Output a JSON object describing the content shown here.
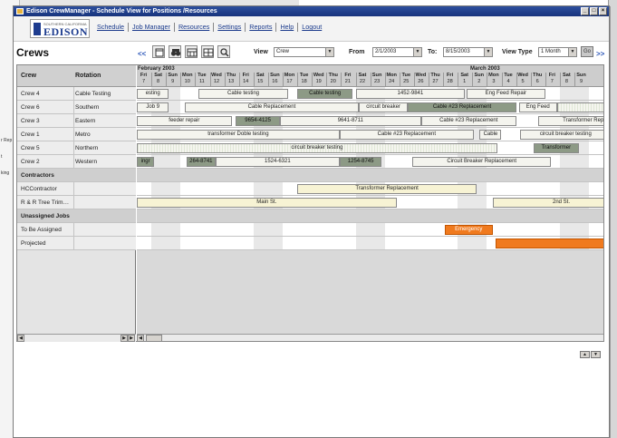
{
  "window": {
    "title": "Edison CrewManager - Schedule View for Positions /Resources"
  },
  "background_doc": {
    "snippets": [
      "r Rep",
      "t",
      "king"
    ]
  },
  "logo": {
    "small": "SOUTHERN CALIFORNIA",
    "big": "EDISON"
  },
  "nav": [
    "Schedule",
    "Job Manager",
    "Resources",
    "Settings",
    "Reports",
    "Help",
    "Logout"
  ],
  "toolbar": {
    "title": "Crews",
    "prev": "<<",
    "next": ">>",
    "view_label": "View",
    "view_value": "Crew",
    "from_label": "From",
    "from_value": "2/1/2003",
    "to_label": "To:",
    "to_value": "8/15/2003",
    "viewtype_label": "View Type",
    "viewtype_value": "1 Month",
    "go": "Go"
  },
  "grid": {
    "col_crew": "Crew",
    "col_rotation": "Rotation",
    "months": [
      "February 2003",
      "March 2003"
    ],
    "days": [
      {
        "d": "Fri",
        "n": "7"
      },
      {
        "d": "Sat",
        "n": "8"
      },
      {
        "d": "Sun",
        "n": "9"
      },
      {
        "d": "Mon",
        "n": "10"
      },
      {
        "d": "Tue",
        "n": "11"
      },
      {
        "d": "Wed",
        "n": "12"
      },
      {
        "d": "Thu",
        "n": "13"
      },
      {
        "d": "Fri",
        "n": "14"
      },
      {
        "d": "Sat",
        "n": "15"
      },
      {
        "d": "Sun",
        "n": "16"
      },
      {
        "d": "Mon",
        "n": "17"
      },
      {
        "d": "Tue",
        "n": "18"
      },
      {
        "d": "Wed",
        "n": "19"
      },
      {
        "d": "Thu",
        "n": "20"
      },
      {
        "d": "Fri",
        "n": "21"
      },
      {
        "d": "Sat",
        "n": "22"
      },
      {
        "d": "Sun",
        "n": "23"
      },
      {
        "d": "Mon",
        "n": "24"
      },
      {
        "d": "Tue",
        "n": "25"
      },
      {
        "d": "Wed",
        "n": "26"
      },
      {
        "d": "Thu",
        "n": "27"
      },
      {
        "d": "Fri",
        "n": "28"
      },
      {
        "d": "Sat",
        "n": "1"
      },
      {
        "d": "Sun",
        "n": "2"
      },
      {
        "d": "Mon",
        "n": "3"
      },
      {
        "d": "Tue",
        "n": "4"
      },
      {
        "d": "Wed",
        "n": "5"
      },
      {
        "d": "Thu",
        "n": "6"
      },
      {
        "d": "Fri",
        "n": "7"
      },
      {
        "d": "Sat",
        "n": "8"
      },
      {
        "d": "Sun",
        "n": "9"
      }
    ],
    "rows": [
      {
        "type": "data",
        "crew": "Crew 4",
        "rotation": "Cable Testing",
        "bars": [
          {
            "s": 0,
            "e": 2.2,
            "t": "esting",
            "k": ""
          },
          {
            "s": 4.2,
            "e": 10.4,
            "t": "Cable testing",
            "k": ""
          },
          {
            "s": 11,
            "e": 14.8,
            "t": "Cable testing",
            "k": "dark"
          },
          {
            "s": 15,
            "e": 22.5,
            "t": "1452-9841",
            "k": ""
          },
          {
            "s": 22.6,
            "e": 28,
            "t": "Eng Feed Repair",
            "k": ""
          }
        ]
      },
      {
        "type": "data",
        "crew": "Crew 6",
        "rotation": "Southern",
        "bars": [
          {
            "s": 0,
            "e": 2.2,
            "t": "Job 9",
            "k": ""
          },
          {
            "s": 3.3,
            "e": 15.2,
            "t": "Cable Replacement",
            "k": ""
          },
          {
            "s": 15.2,
            "e": 18.6,
            "t": "circuit breaker",
            "k": ""
          },
          {
            "s": 18.6,
            "e": 26,
            "t": "Cable #23 Replacement",
            "k": "dark"
          },
          {
            "s": 26.2,
            "e": 28.8,
            "t": "Eng Feed",
            "k": ""
          },
          {
            "s": 28.8,
            "e": 34,
            "t": "",
            "k": "stripe"
          }
        ]
      },
      {
        "type": "data",
        "crew": "Crew 3",
        "rotation": "Eastern",
        "bars": [
          {
            "s": 0,
            "e": 6.5,
            "t": "feeder repair",
            "k": ""
          },
          {
            "s": 6.8,
            "e": 9.8,
            "t": "9654-4125",
            "k": "dark"
          },
          {
            "s": 9.8,
            "e": 19.5,
            "t": "9641-8711",
            "k": ""
          },
          {
            "s": 19.5,
            "e": 26,
            "t": "Cable #23 Replacement",
            "k": ""
          },
          {
            "s": 27.5,
            "e": 34,
            "t": "Transformer Repla",
            "k": ""
          }
        ]
      },
      {
        "type": "data",
        "crew": "Crew 1",
        "rotation": "Metro",
        "bars": [
          {
            "s": 0,
            "e": 13.9,
            "t": "transformer Doble testing",
            "k": ""
          },
          {
            "s": 13.9,
            "e": 23.1,
            "t": "Cable #23 Replacement",
            "k": ""
          },
          {
            "s": 23.5,
            "e": 25,
            "t": "Cable",
            "k": ""
          },
          {
            "s": 26.3,
            "e": 32.5,
            "t": "circuit breaker testing",
            "k": ""
          }
        ]
      },
      {
        "type": "data",
        "crew": "Crew 5",
        "rotation": "Northern",
        "bars": [
          {
            "s": 0,
            "e": 24.7,
            "t": "circuit breaker testing",
            "k": "stripe"
          },
          {
            "s": 27.2,
            "e": 30.3,
            "t": "Transformer",
            "k": "dark"
          }
        ]
      },
      {
        "type": "data",
        "crew": "Crew 2",
        "rotation": "Western",
        "bars": [
          {
            "s": 0,
            "e": 1.2,
            "t": "ingr",
            "k": "dark"
          },
          {
            "s": 3.4,
            "e": 5.4,
            "t": "264-8741",
            "k": "dark"
          },
          {
            "s": 5.4,
            "e": 13.9,
            "t": "1524-6321",
            "k": ""
          },
          {
            "s": 13.9,
            "e": 16.8,
            "t": "1254-8745",
            "k": "dark"
          },
          {
            "s": 18.9,
            "e": 28.4,
            "t": "Circuit Breaker Replacement",
            "k": ""
          }
        ]
      },
      {
        "type": "section",
        "crew": "Contractors",
        "rotation": "",
        "bars": []
      },
      {
        "type": "data",
        "crew": "HCContractor",
        "rotation": "",
        "bars": [
          {
            "s": 11,
            "e": 23.3,
            "t": "Transformer Replacement",
            "k": "yellow"
          }
        ]
      },
      {
        "type": "data",
        "crew": "R & R Tree Trim…",
        "rotation": "",
        "bars": [
          {
            "s": 0,
            "e": 17.8,
            "t": "Main St.",
            "k": "yellow"
          },
          {
            "s": 24.4,
            "e": 33.8,
            "t": "2nd St.",
            "k": "yellow"
          }
        ]
      },
      {
        "type": "section",
        "crew": "Unassigned Jobs",
        "rotation": "",
        "bars": []
      },
      {
        "type": "data",
        "crew": "To Be Assigned",
        "rotation": "",
        "bars": [
          {
            "s": 21.1,
            "e": 24.4,
            "t": "Emergency",
            "k": "orange"
          }
        ]
      },
      {
        "type": "data",
        "crew": "Projected",
        "rotation": "",
        "bars": [
          {
            "s": 24.6,
            "e": 34.5,
            "t": "",
            "k": "orange"
          }
        ]
      }
    ]
  },
  "footer": {
    "up": "▲",
    "down": "▼"
  }
}
